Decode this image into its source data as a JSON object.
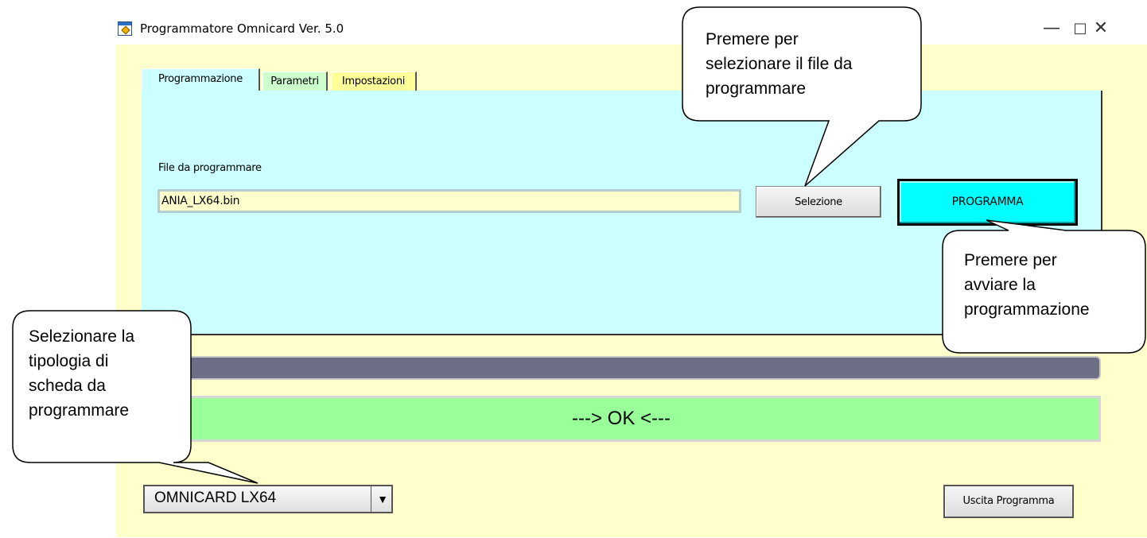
{
  "window": {
    "title": "Programmatore Omnicard Ver. 5.0",
    "minimize": "—",
    "maximize": "□",
    "close": "✕",
    "icon": "app-icon"
  },
  "tabs": [
    {
      "label": "Programmazione",
      "active": true,
      "color": "#ccffff"
    },
    {
      "label": "Parametri",
      "active": false,
      "color": "#ccffcc"
    },
    {
      "label": "Impostazioni",
      "active": false,
      "color": "#ffff99"
    }
  ],
  "programmazione": {
    "file_label": "File da programmare",
    "file_value": "ANIA_LX64.bin",
    "select_button": "Selezione",
    "program_button": "PROGRAMMA"
  },
  "progress": {
    "value": 0
  },
  "status": {
    "text": "---> OK <---",
    "color": "#99ff99"
  },
  "board": {
    "selected": "OMNICARD LX64",
    "arrow": "▼"
  },
  "exit_button": "Uscita Programma",
  "callouts": {
    "select_file": [
      "Premere per",
      "selezionare il file da",
      "programmare"
    ],
    "start_program": [
      "Premere per",
      "avviare la",
      "programmazione"
    ],
    "board_type": [
      "Selezionare la",
      "tipologia di",
      "scheda da",
      "programmare"
    ]
  },
  "colors": {
    "client_bg": "#ffffcc",
    "panel_bg": "#ccffff",
    "program_button": "#00ffff",
    "progress_track": "#6e6e86"
  }
}
